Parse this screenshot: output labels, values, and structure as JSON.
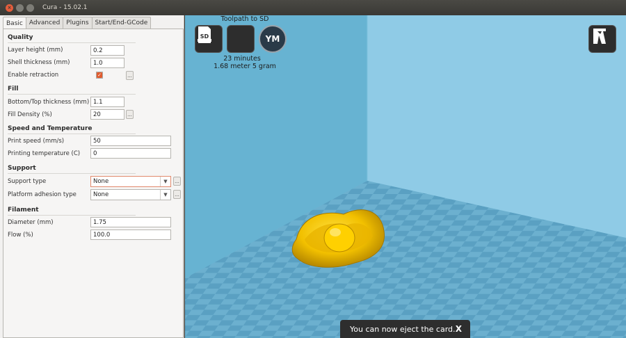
{
  "window": {
    "title": "Cura - 15.02.1"
  },
  "tabs": [
    {
      "label": "Basic",
      "active": true
    },
    {
      "label": "Advanced"
    },
    {
      "label": "Plugins"
    },
    {
      "label": "Start/End-GCode"
    }
  ],
  "sections": {
    "quality": {
      "title": "Quality",
      "layer_height": {
        "label": "Layer height (mm)",
        "value": "0.2"
      },
      "shell_thickness": {
        "label": "Shell thickness (mm)",
        "value": "1.0"
      },
      "enable_retraction": {
        "label": "Enable retraction",
        "checked": true,
        "more": "..."
      }
    },
    "fill": {
      "title": "Fill",
      "bottom_top": {
        "label": "Bottom/Top thickness (mm)",
        "value": "1.1"
      },
      "fill_density": {
        "label": "Fill Density (%)",
        "value": "20",
        "more": "..."
      }
    },
    "speed": {
      "title": "Speed and Temperature",
      "print_speed": {
        "label": "Print speed (mm/s)",
        "value": "50"
      },
      "print_temp": {
        "label": "Printing temperature (C)",
        "value": "0"
      }
    },
    "support": {
      "title": "Support",
      "support_type": {
        "label": "Support type",
        "value": "None",
        "more": "..."
      },
      "platform_adhesion": {
        "label": "Platform adhesion type",
        "value": "None",
        "more": "..."
      }
    },
    "filament": {
      "title": "Filament",
      "diameter": {
        "label": "Diameter (mm)",
        "value": "1.75"
      },
      "flow": {
        "label": "Flow (%)",
        "value": "100.0"
      }
    }
  },
  "viewport": {
    "toolpath_label": "Toolpath to SD",
    "time_text": "23 minutes",
    "material_text": "1.68 meter 5 gram",
    "sd_icon_label": "SD",
    "ym_icon_label": "YM",
    "toast": {
      "message": "You can now eject the card.",
      "close": "X"
    }
  },
  "colors": {
    "model": "#f5c400",
    "checkbox_accent": "#e05b2e"
  }
}
